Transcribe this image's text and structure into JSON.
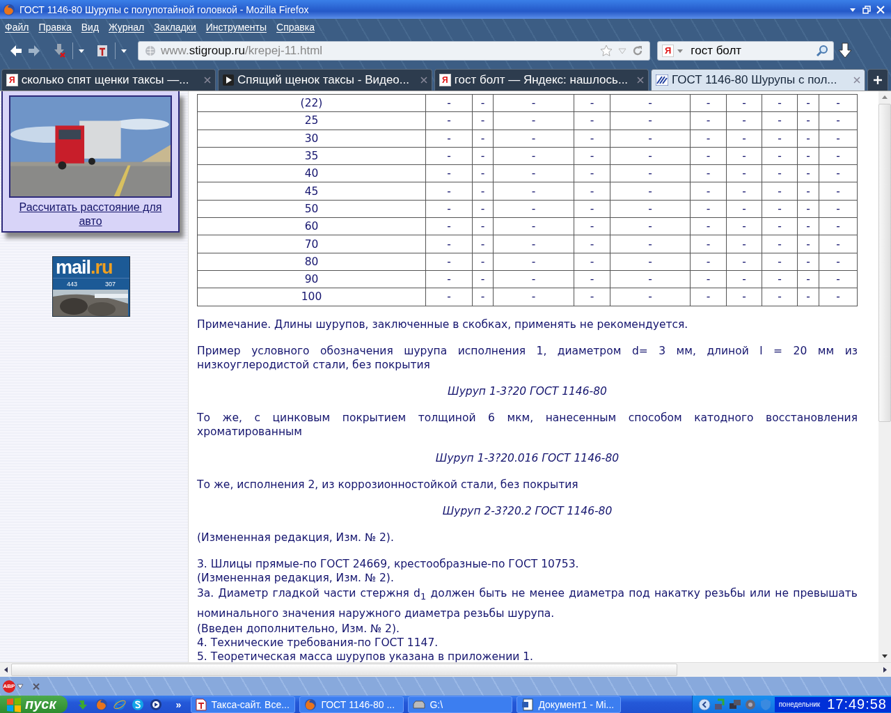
{
  "window": {
    "title": "ГОСТ 1146-80 Шурупы с полупотайной головкой - Mozilla Firefox"
  },
  "menu": [
    "Файл",
    "Правка",
    "Вид",
    "Журнал",
    "Закладки",
    "Инструменты",
    "Справка"
  ],
  "address": {
    "prefix": "www.",
    "domain": "stigroup.ru",
    "path": "/krepej-11.html"
  },
  "search": {
    "engine_mark": "Я",
    "value": "гост болт"
  },
  "tabs": [
    {
      "kind": "yandex",
      "mark": "Я",
      "label": "сколько спят щенки таксы —...",
      "selected": false
    },
    {
      "kind": "video",
      "label": "Спящий щенок таксы - Видео...",
      "selected": false
    },
    {
      "kind": "yandex",
      "mark": "Я",
      "label": "гост болт — Яндекс: нашлось...",
      "selected": false
    },
    {
      "kind": "site",
      "label": "ГОСТ 1146-80 Шурупы с пол...",
      "selected": true
    }
  ],
  "sidebar": {
    "link": "Рассчитать расстояние для авто",
    "counter": {
      "logo_main": "mail",
      "logo_domain": ".ru",
      "values": [
        "443",
        "307"
      ]
    }
  },
  "table": {
    "rows": [
      {
        "length": "(22)",
        "cells": [
          "-",
          "-",
          "-",
          "-",
          "-",
          "-",
          "-",
          "-",
          "-",
          "-"
        ]
      },
      {
        "length": "25",
        "cells": [
          "-",
          "-",
          "-",
          "-",
          "-",
          "-",
          "-",
          "-",
          "-",
          "-"
        ]
      },
      {
        "length": "30",
        "cells": [
          "-",
          "-",
          "-",
          "-",
          "-",
          "-",
          "-",
          "-",
          "-",
          "-"
        ]
      },
      {
        "length": "35",
        "cells": [
          "-",
          "-",
          "-",
          "-",
          "-",
          "-",
          "-",
          "-",
          "-",
          "-"
        ]
      },
      {
        "length": "40",
        "cells": [
          "-",
          "-",
          "-",
          "-",
          "-",
          "-",
          "-",
          "-",
          "-",
          "-"
        ]
      },
      {
        "length": "45",
        "cells": [
          "-",
          "-",
          "-",
          "-",
          "-",
          "-",
          "-",
          "-",
          "-",
          "-"
        ]
      },
      {
        "length": "50",
        "cells": [
          "-",
          "-",
          "-",
          "-",
          "-",
          "-",
          "-",
          "-",
          "-",
          "-"
        ]
      },
      {
        "length": "60",
        "cells": [
          "-",
          "-",
          "-",
          "-",
          "-",
          "-",
          "-",
          "-",
          "-",
          "-"
        ]
      },
      {
        "length": "70",
        "cells": [
          "-",
          "-",
          "-",
          "-",
          "-",
          "-",
          "-",
          "-",
          "-",
          "-"
        ]
      },
      {
        "length": "80",
        "cells": [
          "-",
          "-",
          "-",
          "-",
          "-",
          "-",
          "-",
          "-",
          "-",
          "-"
        ]
      },
      {
        "length": "90",
        "cells": [
          "-",
          "-",
          "-",
          "-",
          "-",
          "-",
          "-",
          "-",
          "-",
          "-"
        ]
      },
      {
        "length": "100",
        "cells": [
          "-",
          "-",
          "-",
          "-",
          "-",
          "-",
          "-",
          "-",
          "-",
          "-"
        ]
      }
    ]
  },
  "content": [
    {
      "kind": "para",
      "text": "Примечание. Длины шурупов, заключенные в скобках, применять не рекомендуется."
    },
    {
      "kind": "justified",
      "text": "Пример условного обозначения шурупа исполнения 1, диаметром d= 3 мм, длиной l = 20 мм из низкоуглеродистой стали, без покрытия"
    },
    {
      "kind": "formula",
      "text": "Шуруп 1-3?20 ГОСТ 1146-80"
    },
    {
      "kind": "justified",
      "text": "То же, с цинковым покрытием толщиной 6 мкм, нанесенным способом катодного восстановления хроматированным"
    },
    {
      "kind": "formula",
      "text": "Шуруп 1-3?20.016 ГОСТ 1146-80"
    },
    {
      "kind": "para",
      "text": "То же, исполнения 2, из коррозионностойкой стали, без покрытия"
    },
    {
      "kind": "formula",
      "text": "Шуруп 2-3?20.2 ГОСТ 1146-80"
    },
    {
      "kind": "para",
      "text": "(Измененная редакция, Изм. № 2)."
    },
    {
      "kind": "line",
      "text": "3. Шлицы прямые-по ГОСТ 24669, крестообразные-по ГОСТ 10753."
    },
    {
      "kind": "line",
      "text": "(Измененная редакция, Изм. № 2)."
    },
    {
      "kind": "justified_line",
      "text": "3а. Диаметр гладкой части стержня d$_{1}$ должен быть не менее диаметра под накатку резьбы или не превышать номинального значения наружного диаметра резьбы шурупа."
    },
    {
      "kind": "line",
      "text": "(Введен дополнительно, Изм. № 2)."
    },
    {
      "kind": "line",
      "text": "4. Технические требования-по ГОСТ 1147."
    },
    {
      "kind": "line",
      "text": "5. Теоретическая масса шурупов указана в приложении 1."
    }
  ],
  "addon_bar": {
    "adblock_label": "ABP"
  },
  "taskbar": {
    "start": "пуск",
    "more": "»",
    "tasks": [
      {
        "kind": "pdf",
        "label": "Такса-сайт. Все..."
      },
      {
        "kind": "browser",
        "label": "ГОСТ 1146-80 ..."
      },
      {
        "kind": "drive",
        "label": "G:\\"
      },
      {
        "kind": "document",
        "label": "Документ1 - Mi..."
      }
    ],
    "day": "понедельник",
    "time": "17:49:58"
  }
}
